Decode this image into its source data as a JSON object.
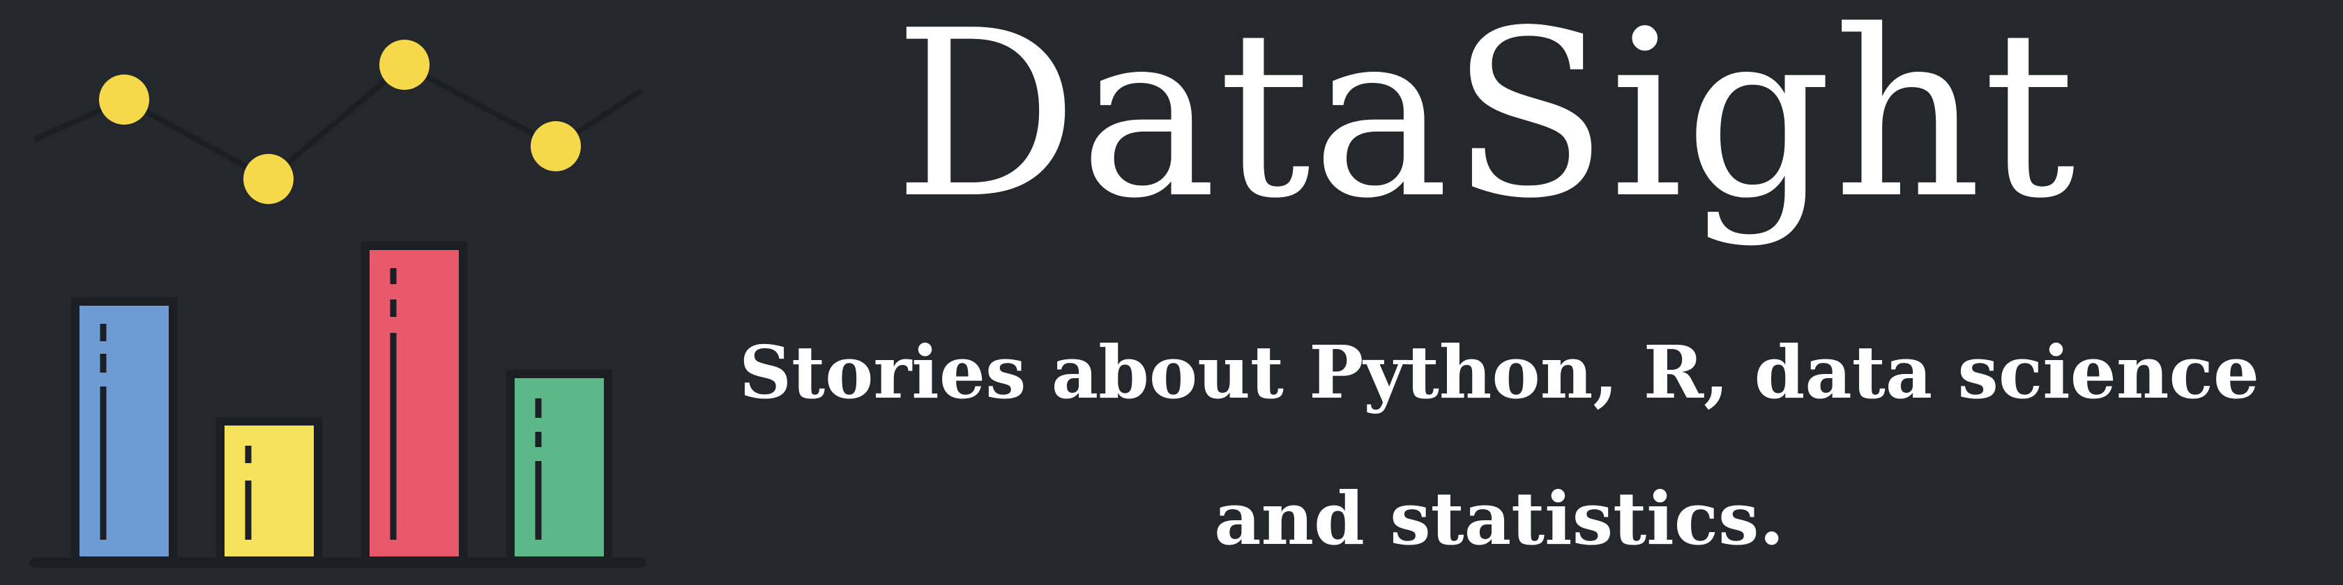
{
  "brand": {
    "title": "DataSight",
    "tagline": "Stories about Python, R, data science and statistics."
  },
  "logo": {
    "icon": "bar-and-line-chart-icon",
    "background": "#24282d",
    "bar_colors": [
      "#6f9bd4",
      "#f5e15a",
      "#e85a6b",
      "#5cb888"
    ],
    "dot_color": "#f5d94a",
    "outline_color": "#1b1e22"
  },
  "colors": {
    "background": "#24282d",
    "text": "#ffffff"
  }
}
